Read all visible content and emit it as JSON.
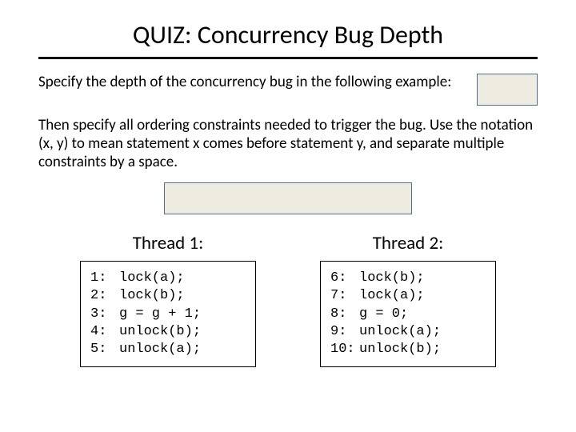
{
  "title": "QUIZ: Concurrency Bug Depth",
  "prompt1": "Specify the depth of the concurrency bug in the following example:",
  "prompt2": "Then specify all ordering constraints needed to trigger the bug. Use the notation (x, y) to mean statement x comes before statement y, and separate multiple constraints by a space.",
  "thread1": {
    "title": "Thread 1:",
    "lines": [
      {
        "n": "1:",
        "c": "lock(a);"
      },
      {
        "n": "2:",
        "c": "lock(b);"
      },
      {
        "n": "3:",
        "c": "g = g + 1;"
      },
      {
        "n": "4:",
        "c": "unlock(b);"
      },
      {
        "n": "5:",
        "c": "unlock(a);"
      }
    ]
  },
  "thread2": {
    "title": "Thread 2:",
    "lines": [
      {
        "n": "6:",
        "c": "lock(b);"
      },
      {
        "n": "7:",
        "c": "lock(a);"
      },
      {
        "n": "8:",
        "c": "g = 0;"
      },
      {
        "n": "9:",
        "c": "unlock(a);"
      },
      {
        "n": "10:",
        "c": "unlock(b);"
      }
    ]
  }
}
